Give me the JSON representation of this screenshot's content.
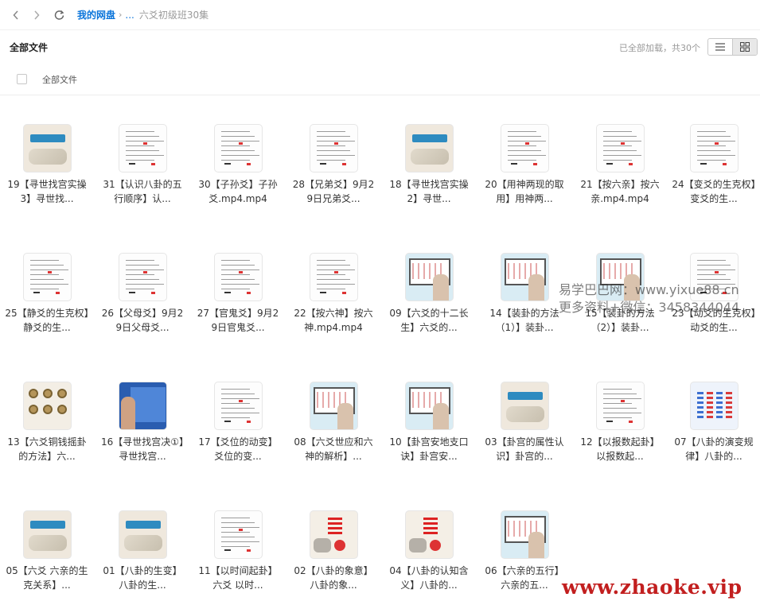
{
  "nav": {
    "back_icon": "chevron-left-icon",
    "forward_icon": "chevron-right-icon",
    "refresh_icon": "refresh-icon"
  },
  "breadcrumb": {
    "root": "我的网盘",
    "separator": "›",
    "ellipsis": "...",
    "current": "六爻初级班30集"
  },
  "header": {
    "title": "全部文件",
    "status": "已全部加载，共30个",
    "list_view_icon": "list-view-icon",
    "grid_view_icon": "grid-view-icon"
  },
  "selectbar": {
    "label": "全部文件"
  },
  "files": [
    {
      "name": "19【寻世找宫实操3】寻世找...",
      "thumb": "slide"
    },
    {
      "name": "31【认识八卦的五行顺序】认...",
      "thumb": "doc"
    },
    {
      "name": "30【子孙爻】子孙爻.mp4.mp4",
      "thumb": "doc"
    },
    {
      "name": "28【兄弟爻】9月29日兄弟爻...",
      "thumb": "doc"
    },
    {
      "name": "18【寻世找宫实操2】寻世...",
      "thumb": "slide"
    },
    {
      "name": "20【用神两现的取用】用神两...",
      "thumb": "doc"
    },
    {
      "name": "21【按六亲】按六亲.mp4.mp4",
      "thumb": "doc"
    },
    {
      "name": "24【变爻的生克权】变爻的生...",
      "thumb": "doc"
    },
    {
      "name": "25【静爻的生克权】静爻的生...",
      "thumb": "doc"
    },
    {
      "name": "26【父母爻】9月29日父母爻...",
      "thumb": "doc"
    },
    {
      "name": "27【官鬼爻】9月29日官鬼爻...",
      "thumb": "doc"
    },
    {
      "name": "22【按六神】按六神.mp4.mp4",
      "thumb": "doc"
    },
    {
      "name": "09【六爻的十二长生】六爻的...",
      "thumb": "board"
    },
    {
      "name": "14【装卦的方法（1）】装卦...",
      "thumb": "board"
    },
    {
      "name": "15【装卦的方法（2）】装卦...",
      "thumb": "board"
    },
    {
      "name": "23【动爻的生克权】动爻的生...",
      "thumb": "doc"
    },
    {
      "name": "13【六爻铜钱摇卦的方法】六...",
      "thumb": "coins"
    },
    {
      "name": "16【寻世找宫决①】寻世找宫...",
      "thumb": "teacher"
    },
    {
      "name": "17【爻位的动变】爻位的变...",
      "thumb": "doc"
    },
    {
      "name": "08【六爻世应和六神的解析】...",
      "thumb": "board"
    },
    {
      "name": "10【卦宫安地支口诀】卦宫安...",
      "thumb": "board"
    },
    {
      "name": "03【卦宫的属性认识】卦宫的...",
      "thumb": "slide"
    },
    {
      "name": "12【以报数起卦】以报数起...",
      "thumb": "doc"
    },
    {
      "name": "07【八卦的演变规律】八卦的...",
      "thumb": "hex"
    },
    {
      "name": "05【六爻 六亲的生克关系】...",
      "thumb": "slide"
    },
    {
      "name": "01【八卦的生变】八卦的生...",
      "thumb": "slide"
    },
    {
      "name": "11【以时间起卦】六爻 以时...",
      "thumb": "doc"
    },
    {
      "name": "02【八卦的象意】八卦的象...",
      "thumb": "red"
    },
    {
      "name": "04【八卦的认知含义】八卦的...",
      "thumb": "red"
    },
    {
      "name": "06【六亲的五行】六亲的五...",
      "thumb": "board"
    }
  ],
  "watermark": {
    "line1": "易学巴巴网：www.yixue88.cn",
    "line2": "更多资料+微信：3458344044"
  },
  "footer_watermark": "www.zhaoke.vip"
}
